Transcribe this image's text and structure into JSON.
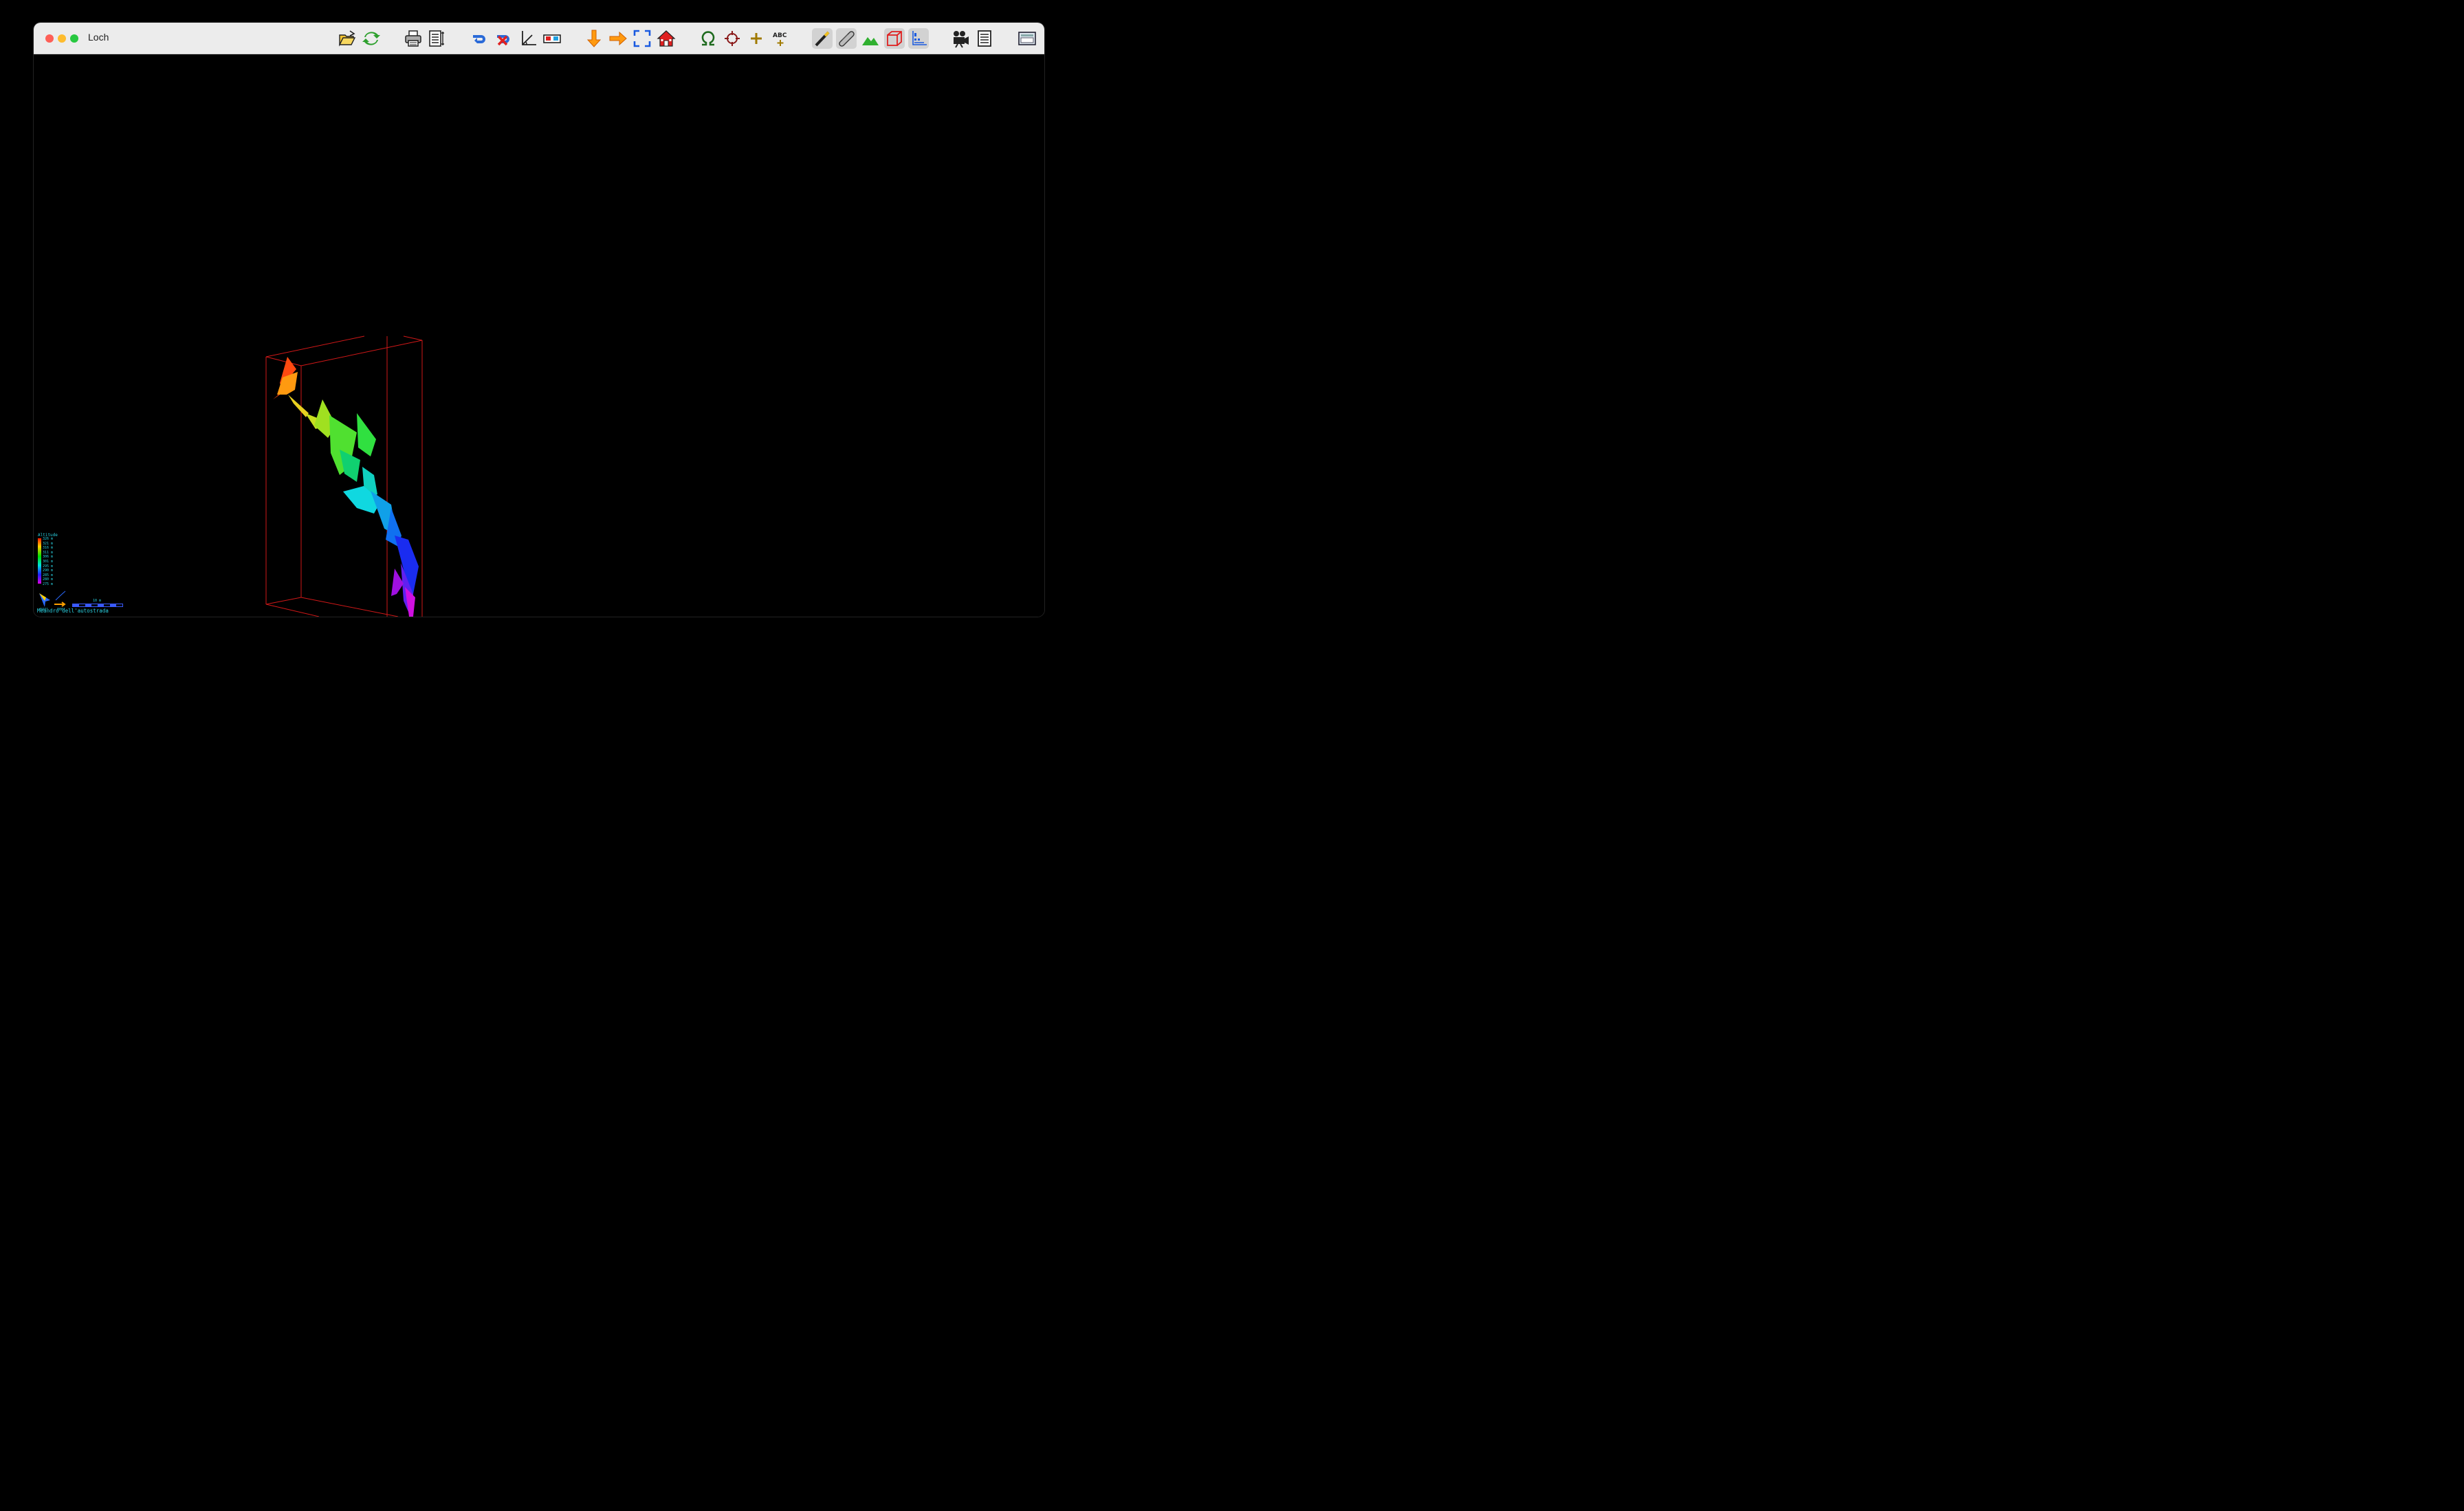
{
  "window": {
    "title": "Loch"
  },
  "toolbar": {
    "buttons": [
      {
        "id": "open",
        "icon": "open-folder-icon"
      },
      {
        "id": "reload",
        "icon": "reload-icon"
      },
      {
        "id": "print",
        "icon": "printer-icon"
      },
      {
        "id": "print-setup",
        "icon": "page-setup-icon"
      },
      {
        "id": "rotate",
        "icon": "rotate-icon"
      },
      {
        "id": "rotate-reverse",
        "icon": "rotate-reverse-icon"
      },
      {
        "id": "tilt",
        "icon": "tilt-angle-icon"
      },
      {
        "id": "stereo",
        "icon": "stereo-glasses-icon"
      },
      {
        "id": "plan",
        "icon": "plan-view-icon"
      },
      {
        "id": "elevation",
        "icon": "elevation-view-icon"
      },
      {
        "id": "zoom-fit",
        "icon": "zoom-fit-icon"
      },
      {
        "id": "home",
        "icon": "home-icon"
      },
      {
        "id": "entrances",
        "icon": "omega-entrance-icon"
      },
      {
        "id": "fixed-points",
        "icon": "crosshair-icon"
      },
      {
        "id": "stations",
        "icon": "plus-station-icon"
      },
      {
        "id": "labels",
        "icon": "abc-labels-icon"
      },
      {
        "id": "centerline",
        "icon": "centerline-icon",
        "pressed": true
      },
      {
        "id": "walls",
        "icon": "walls-tube-icon",
        "pressed": true
      },
      {
        "id": "surface",
        "icon": "surface-terrain-icon"
      },
      {
        "id": "bbox",
        "icon": "bounding-box-icon",
        "pressed": true
      },
      {
        "id": "indicators",
        "icon": "indicators-icon",
        "pressed": true
      },
      {
        "id": "camera",
        "icon": "movie-camera-icon"
      },
      {
        "id": "info",
        "icon": "info-panel-icon"
      },
      {
        "id": "fullscreen",
        "icon": "window-fullscreen-icon"
      }
    ]
  },
  "viewport": {
    "background": "#000000",
    "box_color": "#d01818",
    "legend": {
      "title": "Altitude",
      "labels": [
        "326 m",
        "321 m",
        "316 m",
        "311 m",
        "306 m",
        "301 m",
        "295 m",
        "290 m",
        "285 m",
        "280 m",
        "275 m"
      ]
    },
    "compass": {
      "heading": "044°",
      "tilt": "000°"
    },
    "scale": {
      "label": "10 m"
    },
    "cave_name": "Meandro dell'autostrada"
  }
}
